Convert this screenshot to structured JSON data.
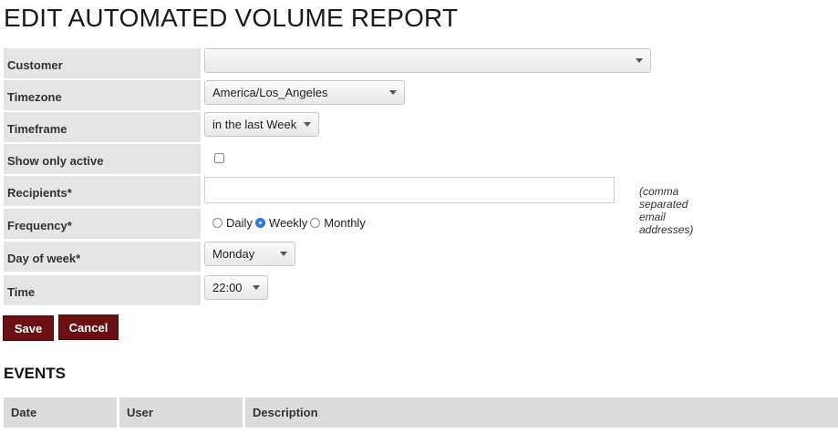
{
  "page": {
    "title": "EDIT AUTOMATED VOLUME REPORT"
  },
  "form": {
    "customer": {
      "label": "Customer",
      "value": ""
    },
    "timezone": {
      "label": "Timezone",
      "value": "America/Los_Angeles"
    },
    "timeframe": {
      "label": "Timeframe",
      "value": "in the last Week"
    },
    "show_only_active": {
      "label": "Show only active",
      "checked": false
    },
    "recipients": {
      "label": "Recipients*",
      "value": "",
      "hint": "(comma separated email addresses)"
    },
    "frequency": {
      "label": "Frequency*",
      "options": [
        "Daily",
        "Weekly",
        "Monthly"
      ],
      "selected": "Weekly"
    },
    "day_of_week": {
      "label": "Day of week*",
      "value": "Monday"
    },
    "time": {
      "label": "Time",
      "value": "22:00"
    }
  },
  "actions": {
    "save_label": "Save",
    "cancel_label": "Cancel"
  },
  "events": {
    "title": "EVENTS",
    "columns": [
      "Date",
      "User",
      "Description"
    ]
  },
  "colors": {
    "button_bg": "#6b0f12",
    "label_bg": "#e5e5e5",
    "radio_selected": "#2b7be8"
  }
}
